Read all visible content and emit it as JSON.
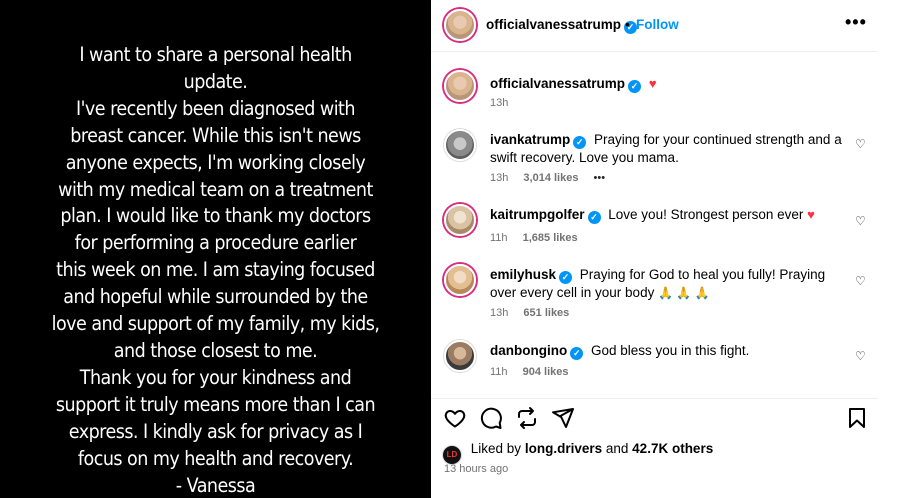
{
  "story": {
    "text": "I want to share a personal health\nupdate.\nI've recently been diagnosed with\nbreast cancer. While this isn't news\nanyone expects, I'm working closely\nwith my medical team on a treatment\nplan. I would like to thank my doctors\nfor performing a procedure earlier\nthis week on me. I am staying focused\nand hopeful while surrounded by the\nlove and support of my family, my kids,\nand those closest to me.\nThank you for your kindness and\nsupport it truly means more than I can\nexpress. I kindly ask for privacy as I\nfocus on my health and recovery.\n- Vanessa"
  },
  "header": {
    "username": "officialvanessatrump",
    "dot": "•",
    "follow_label": "Follow",
    "more_icon": "more-horizontal-icon",
    "more_glyph": "•••"
  },
  "caption": {
    "username": "officialvanessatrump",
    "heart": "♥",
    "time": "13h"
  },
  "comments": [
    {
      "username": "ivankatrump",
      "text": "Praying for your continued strength and a swift recovery. Love you mama.",
      "time": "13h",
      "likes": "3,014 likes",
      "extra": "•••"
    },
    {
      "username": "kaitrumpgolfer",
      "text": "Love you! Strongest person ever",
      "heart": "♥",
      "time": "11h",
      "likes": "1,685 likes"
    },
    {
      "username": "emilyhusk",
      "text": "Praying for God to heal you fully! Praying over every cell in your body",
      "emoji": "🙏 🙏 🙏",
      "time": "13h",
      "likes": "651 likes"
    },
    {
      "username": "danbongino",
      "text": "God bless you in this fight.",
      "time": "11h",
      "likes": "904 likes"
    }
  ],
  "verified_glyph": "✓",
  "comment_like_glyph": "♡",
  "liked_by": {
    "avatar_text": "LD",
    "prefix": "Liked by",
    "user": "long.drivers",
    "middle": "and",
    "count": "42.7K others"
  },
  "posted_ago": "13 hours ago",
  "colors": {
    "accent": "#0095f6",
    "heart": "#ff3040",
    "story_bg": "#000000",
    "muted": "#737373"
  }
}
